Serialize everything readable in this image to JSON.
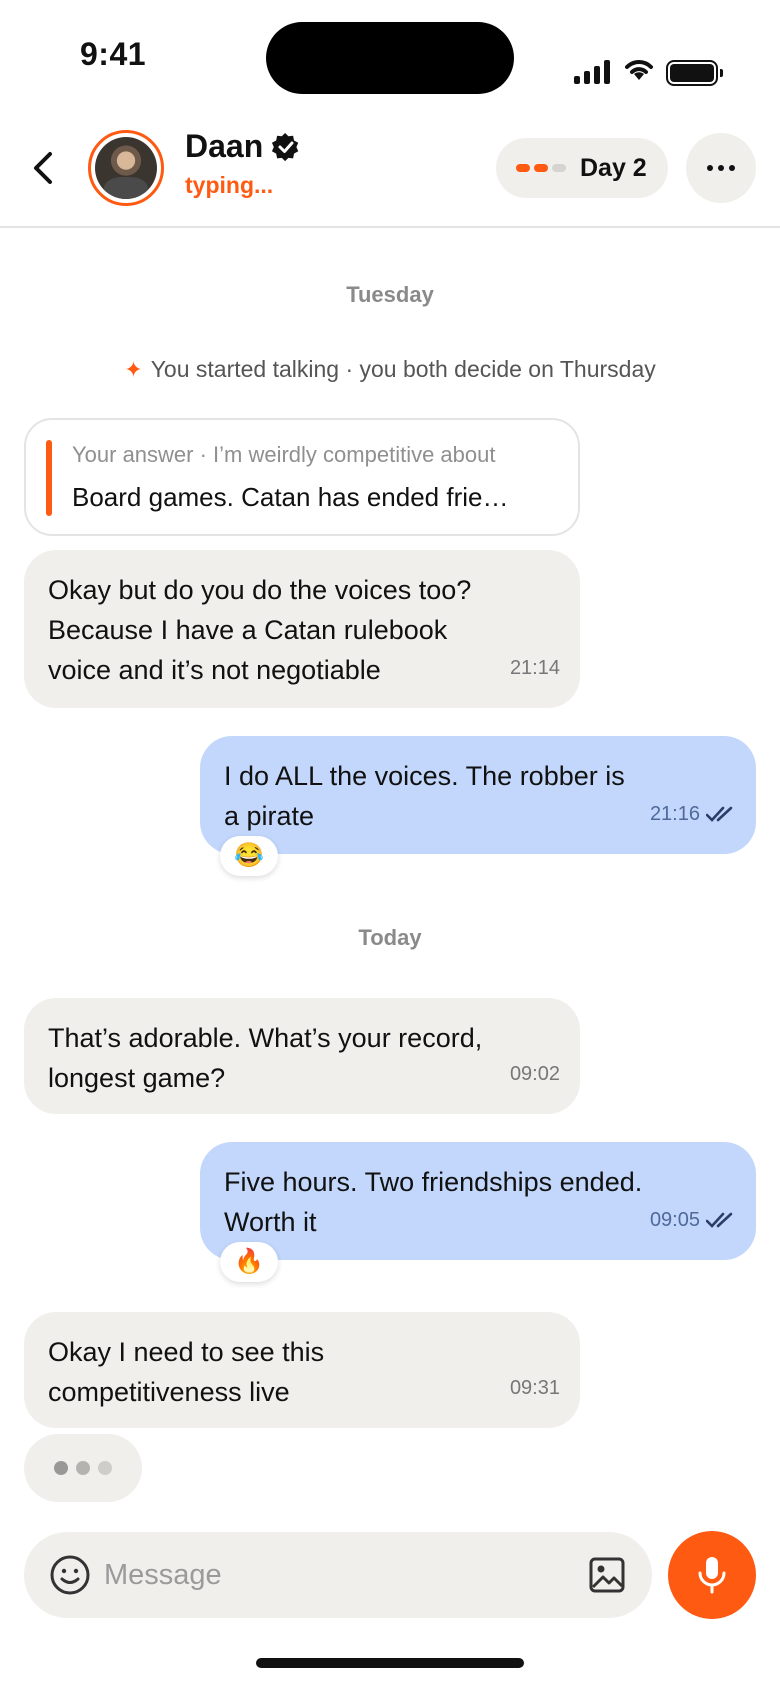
{
  "status": {
    "time": "9:41"
  },
  "header": {
    "name": "Daan",
    "status_text": "typing...",
    "day_label": "Day 2",
    "streak_colors": [
      "#ff5a12",
      "#ff5a12",
      "#d6d4d0"
    ]
  },
  "chat": {
    "sep_tuesday": "Tuesday",
    "system_icon": "sparkle-icon",
    "system_text": "You started talking · you both decide on Thursday",
    "quote": {
      "label": "Your answer · I’m weirdly competitive about",
      "text": "Board games. Catan has ended frie…"
    },
    "messages": [
      {
        "side": "in",
        "text": "Okay but do you do the voices too? Because I have a Catan rulebook voice and it’s not negotiable",
        "time": "21:14"
      },
      {
        "side": "out",
        "text": "I do ALL the voices. The robber is a pirate",
        "time": "21:16",
        "reaction": "😂"
      },
      {
        "side": "in",
        "text": "That’s adorable. What’s your record, longest game?",
        "time": "09:02"
      },
      {
        "side": "out",
        "text": "Five hours. Two friendships ended. Worth it",
        "time": "09:05",
        "reaction": "🔥"
      },
      {
        "side": "in",
        "text": "Okay I need to see this competitiveness live",
        "time": "09:31"
      }
    ],
    "sep_today": "Today"
  },
  "composer": {
    "placeholder": "Message"
  },
  "colors": {
    "accent": "#ff5a12",
    "incoming": "#f1efec",
    "outgoing": "#c2d7fb"
  }
}
